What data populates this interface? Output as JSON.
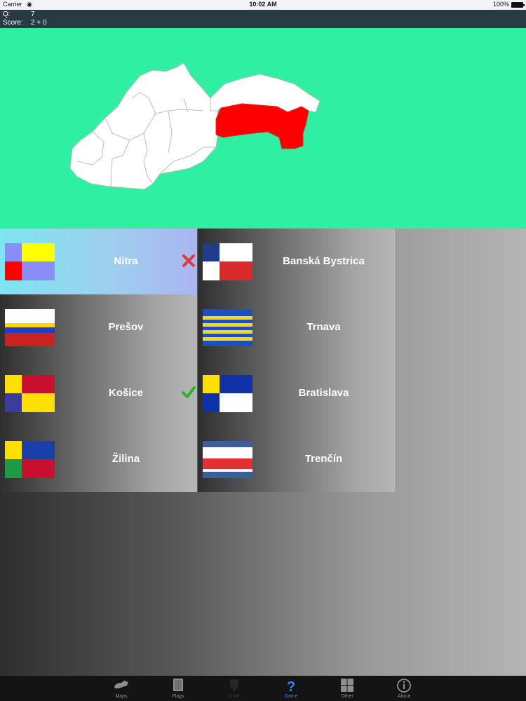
{
  "status_bar": {
    "carrier": "Carrier",
    "time": "10:02 AM",
    "battery": "100%"
  },
  "info": {
    "question_label": "Q:",
    "question_value": "7",
    "score_label": "Score:",
    "score_value": "2 + 0"
  },
  "colors": {
    "map_background": "#2ff0a2",
    "highlighted_region": "#ff0000",
    "other_regions": "#ffffff",
    "tab_active": "#2f86ff"
  },
  "answers": [
    {
      "label": "Nitra",
      "state": "wrong",
      "highlight": true,
      "mark_icon": "x-mark-icon"
    },
    {
      "label": "Banská Bystrica",
      "state": "none"
    },
    {
      "label": "Prešov",
      "state": "none"
    },
    {
      "label": "Trnava",
      "state": "none"
    },
    {
      "label": "Košice",
      "state": "correct",
      "mark_icon": "check-mark-icon"
    },
    {
      "label": "Bratislava",
      "state": "none"
    },
    {
      "label": "Žilina",
      "state": "none"
    },
    {
      "label": "Trenčín",
      "state": "none"
    }
  ],
  "tabs": [
    {
      "label": "Maps",
      "icon": "map-icon"
    },
    {
      "label": "Flags",
      "icon": "flag-icon"
    },
    {
      "label": "Coat",
      "icon": "coat-icon",
      "disabled": true
    },
    {
      "label": "Game",
      "icon": "question-icon",
      "active": true
    },
    {
      "label": "Other",
      "icon": "grid-icon"
    },
    {
      "label": "About",
      "icon": "info-icon"
    }
  ]
}
